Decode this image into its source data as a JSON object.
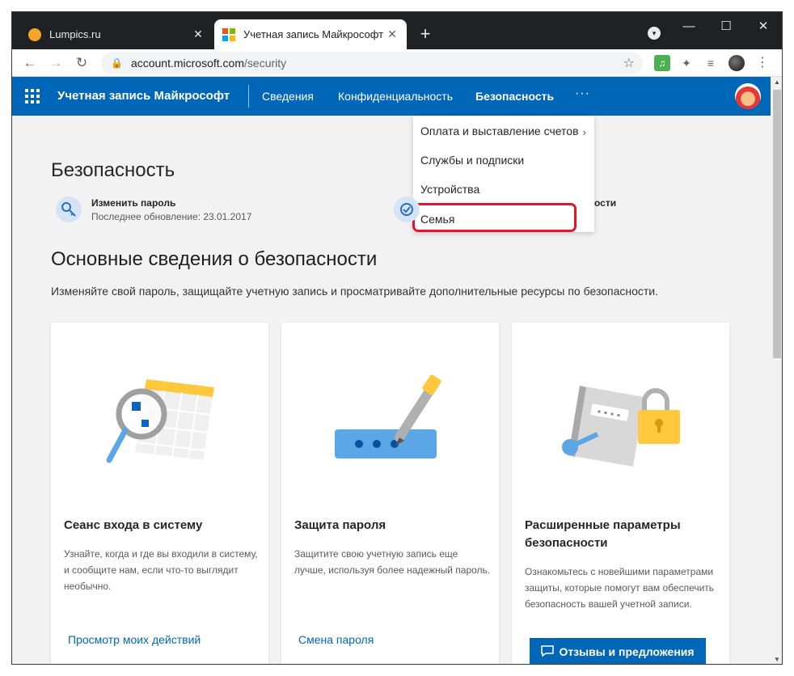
{
  "browser": {
    "tabs": [
      {
        "title": "Lumpics.ru",
        "favicon": "orange-circle-icon",
        "close": "✕"
      },
      {
        "title": "Учетная запись Майкрософт | S",
        "favicon": "microsoft-logo-icon",
        "close": "✕"
      }
    ],
    "new_tab": "+",
    "window_controls": {
      "minimize": "—",
      "maximize": "☐",
      "close": "✕"
    },
    "profile_glyph": "▾",
    "nav": {
      "back": "←",
      "forward": "→",
      "reload": "↻"
    },
    "address": {
      "host": "account.microsoft.com",
      "path": "/security",
      "lock": "🔒",
      "star": "☆"
    },
    "extensions": {
      "music": "♫",
      "puzzle": "✦",
      "media": "≡",
      "menu": "⋮"
    }
  },
  "header": {
    "brand": "Учетная запись Майкрософт",
    "links": [
      "Сведения",
      "Конфиденциальность",
      "Безопасность"
    ],
    "current": "Безопасность",
    "more": "···",
    "accent": "#0067b8"
  },
  "dropdown": {
    "items": [
      "Оплата и выставление счетов",
      "Службы и подписки",
      "Устройства",
      "Семья"
    ],
    "chevron": "›",
    "highlight_color": "#e3142b"
  },
  "security": {
    "title": "Безопасность",
    "change_password": {
      "title": "Изменить пароль",
      "subtitle": "Последнее обновление: 23.01.2017",
      "icon": "key-icon"
    },
    "partial_item": {
      "text": "ости",
      "icon": "shield-check-icon"
    }
  },
  "basics": {
    "title": "Основные сведения о безопасности",
    "description": "Изменяйте свой пароль, защищайте учетную запись и просматривайте дополнительные ресурсы по безопасности."
  },
  "cards": [
    {
      "title": "Сеанс входа в систему",
      "text": "Узнайте, когда и где вы входили в систему, и сообщите нам, если что-то выглядит необычно.",
      "link": "Просмотр моих действий"
    },
    {
      "title": "Защита пароля",
      "text": "Защитите свою учетную запись еще лучше, используя более надежный пароль.",
      "link": "Смена пароля"
    },
    {
      "title": "Расширенные параметры безопасности",
      "text": "Ознакомьтесь с новейшими параметрами защиты, которые помогут вам обеспечить безопасность вашей учетной записи.",
      "link": ""
    }
  ],
  "feedback": {
    "label": "Отзывы и предложения",
    "icon": "chat-icon"
  },
  "scrollbar": {
    "up": "▲",
    "down": "▼"
  }
}
